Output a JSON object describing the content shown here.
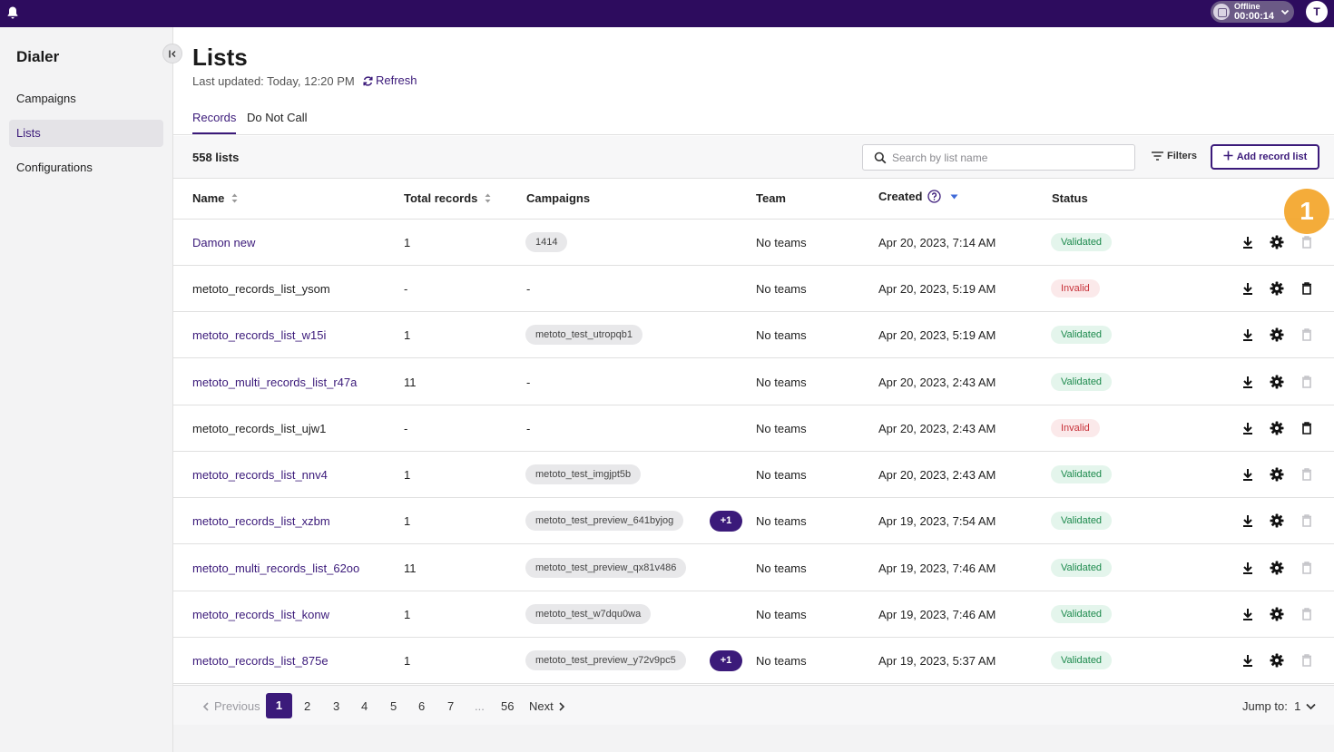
{
  "topbar": {
    "status_label": "Offline",
    "status_time": "00:00:14",
    "avatar_initial": "T"
  },
  "sidebar": {
    "title": "Dialer",
    "items": [
      {
        "label": "Campaigns"
      },
      {
        "label": "Lists"
      },
      {
        "label": "Configurations"
      }
    ]
  },
  "header": {
    "title": "Lists",
    "last_updated": "Last updated: Today, 12:20 PM",
    "refresh_label": "Refresh"
  },
  "tabs": [
    {
      "label": "Records"
    },
    {
      "label": "Do Not Call"
    }
  ],
  "toolbar": {
    "count": "558 lists",
    "search_placeholder": "Search by list name",
    "filters_label": "Filters",
    "add_label": "Add record list"
  },
  "table": {
    "columns": {
      "name": "Name",
      "total": "Total records",
      "campaigns": "Campaigns",
      "team": "Team",
      "created": "Created",
      "status": "Status"
    },
    "rows": [
      {
        "name": "Damon new",
        "total": "1",
        "campaign": "1414",
        "extra": "",
        "team": "No teams",
        "created": "Apr 20, 2023, 7:14 AM",
        "status": "Validated"
      },
      {
        "name": "metoto_records_list_ysom",
        "total": "-",
        "campaign": "-",
        "extra": "",
        "team": "No teams",
        "created": "Apr 20, 2023, 5:19 AM",
        "status": "Invalid"
      },
      {
        "name": "metoto_records_list_w15i",
        "total": "1",
        "campaign": "metoto_test_utropqb1",
        "extra": "",
        "team": "No teams",
        "created": "Apr 20, 2023, 5:19 AM",
        "status": "Validated"
      },
      {
        "name": "metoto_multi_records_list_r47a",
        "total": "11",
        "campaign": "-",
        "extra": "",
        "team": "No teams",
        "created": "Apr 20, 2023, 2:43 AM",
        "status": "Validated"
      },
      {
        "name": "metoto_records_list_ujw1",
        "total": "-",
        "campaign": "-",
        "extra": "",
        "team": "No teams",
        "created": "Apr 20, 2023, 2:43 AM",
        "status": "Invalid"
      },
      {
        "name": "metoto_records_list_nnv4",
        "total": "1",
        "campaign": "metoto_test_imgjpt5b",
        "extra": "",
        "team": "No teams",
        "created": "Apr 20, 2023, 2:43 AM",
        "status": "Validated"
      },
      {
        "name": "metoto_records_list_xzbm",
        "total": "1",
        "campaign": "metoto_test_preview_641byjog",
        "extra": "+1",
        "team": "No teams",
        "created": "Apr 19, 2023, 7:54 AM",
        "status": "Validated"
      },
      {
        "name": "metoto_multi_records_list_62oo",
        "total": "11",
        "campaign": "metoto_test_preview_qx81v486",
        "extra": "",
        "team": "No teams",
        "created": "Apr 19, 2023, 7:46 AM",
        "status": "Validated"
      },
      {
        "name": "metoto_records_list_konw",
        "total": "1",
        "campaign": "metoto_test_w7dqu0wa",
        "extra": "",
        "team": "No teams",
        "created": "Apr 19, 2023, 7:46 AM",
        "status": "Validated"
      },
      {
        "name": "metoto_records_list_875e",
        "total": "1",
        "campaign": "metoto_test_preview_y72v9pc5",
        "extra": "+1",
        "team": "No teams",
        "created": "Apr 19, 2023, 5:37 AM",
        "status": "Validated"
      }
    ]
  },
  "pagination": {
    "previous": "Previous",
    "pages": [
      "1",
      "2",
      "3",
      "4",
      "5",
      "6",
      "7",
      "...",
      "56"
    ],
    "next": "Next",
    "jump_label": "Jump to:",
    "jump_value": "1"
  },
  "callout": {
    "number": "1"
  },
  "colors": {
    "brand": "#2d0c5e",
    "accent": "#3b1a7a",
    "valid": "#1d8a4d",
    "invalid": "#c8323a",
    "callout": "#f4a62a"
  }
}
